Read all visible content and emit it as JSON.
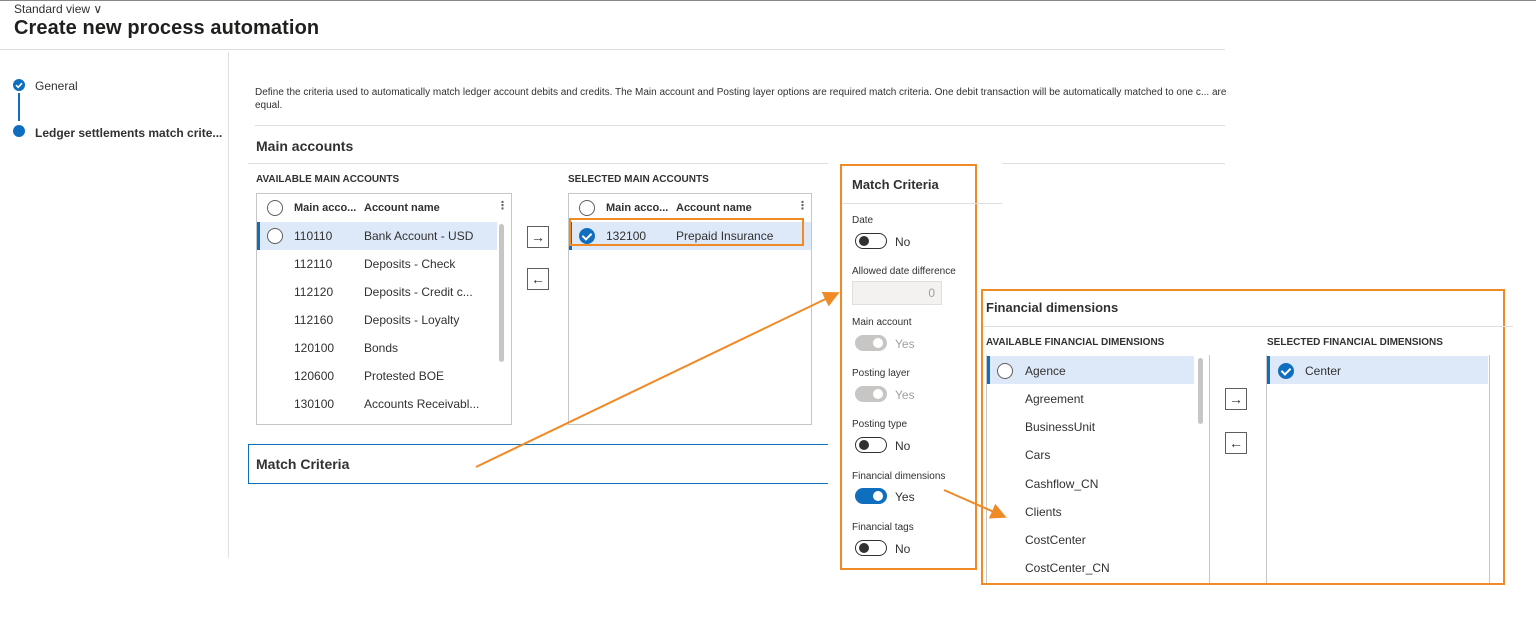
{
  "header": {
    "view_selector": "Standard view ∨",
    "title": "Create new process automation"
  },
  "steps": [
    {
      "label": "General",
      "state": "done"
    },
    {
      "label": "Ledger settlements match crite...",
      "state": "current"
    }
  ],
  "description": "Define the criteria used to automatically match ledger account debits and credits. The Main account and Posting layer options are required match criteria. One debit transaction will be automatically matched to one c... are equal.",
  "main_accounts": {
    "title": "Main accounts",
    "available": {
      "header": "AVAILABLE MAIN ACCOUNTS",
      "col_account": "Main acco...",
      "col_name": "Account name",
      "rows": [
        {
          "account": "110110",
          "name": "Bank Account - USD",
          "selected": true
        },
        {
          "account": "112110",
          "name": "Deposits - Check",
          "selected": false
        },
        {
          "account": "112120",
          "name": "Deposits - Credit c...",
          "selected": false
        },
        {
          "account": "112160",
          "name": "Deposits - Loyalty",
          "selected": false
        },
        {
          "account": "120100",
          "name": "Bonds",
          "selected": false
        },
        {
          "account": "120600",
          "name": "Protested BOE",
          "selected": false
        },
        {
          "account": "130100",
          "name": "Accounts Receivabl...",
          "selected": false
        }
      ]
    },
    "selected": {
      "header": "SELECTED MAIN ACCOUNTS",
      "col_account": "Main acco...",
      "col_name": "Account name",
      "rows": [
        {
          "account": "132100",
          "name": "Prepaid Insurance"
        }
      ]
    },
    "add_arrow": "→",
    "remove_arrow": "←"
  },
  "match_criteria_section": {
    "title": "Match Criteria"
  },
  "match_criteria_panel": {
    "title": "Match Criteria",
    "date": {
      "label": "Date",
      "value": "No"
    },
    "allowed_date_difference": {
      "label": "Allowed date difference",
      "value": "0"
    },
    "main_account": {
      "label": "Main account",
      "value": "Yes"
    },
    "posting_layer": {
      "label": "Posting layer",
      "value": "Yes"
    },
    "posting_type": {
      "label": "Posting type",
      "value": "No"
    },
    "financial_dimensions": {
      "label": "Financial dimensions",
      "value": "Yes"
    },
    "financial_tags": {
      "label": "Financial tags",
      "value": "No"
    }
  },
  "financial_dimensions": {
    "title": "Financial dimensions",
    "available_header": "AVAILABLE FINANCIAL DIMENSIONS",
    "selected_header": "SELECTED FINANCIAL DIMENSIONS",
    "available": [
      "Agence",
      "Agreement",
      "BusinessUnit",
      "Cars",
      "Cashflow_CN",
      "Clients",
      "CostCenter",
      "CostCenter_CN"
    ],
    "selected": [
      "Center"
    ],
    "add_arrow": "→",
    "remove_arrow": "←"
  },
  "colors": {
    "accent": "#106ebe",
    "highlight": "#f08a24",
    "selected_row": "#dde9f8"
  }
}
